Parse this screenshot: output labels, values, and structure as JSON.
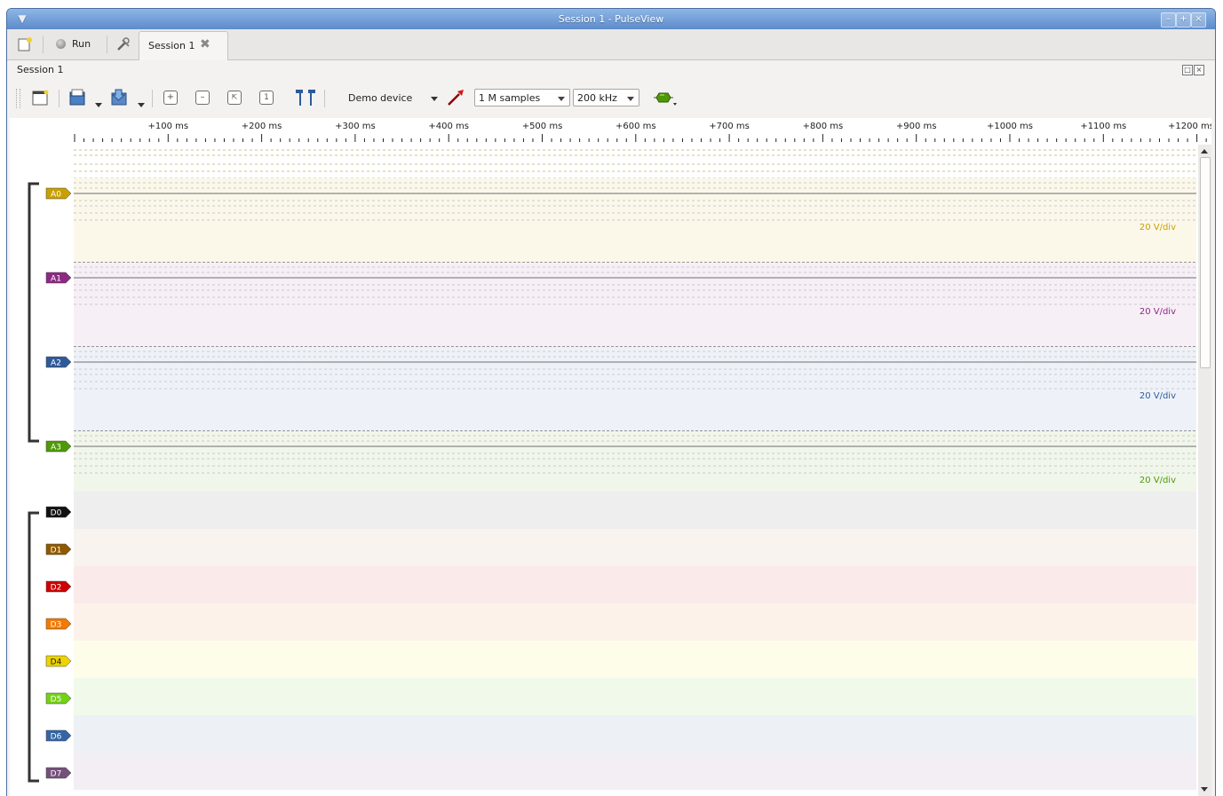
{
  "window": {
    "title": "Session 1 - PulseView"
  },
  "tabbar": {
    "run_label": "Run",
    "session_tab_label": "Session 1"
  },
  "dock": {
    "title": "Session 1"
  },
  "toolbar": {
    "device": "Demo device",
    "samples": "1 M samples",
    "rate": "200 kHz"
  },
  "ruler": {
    "labels": [
      "+100 ms",
      "+200 ms",
      "+300 ms",
      "+400 ms",
      "+500 ms",
      "+600 ms",
      "+700 ms",
      "+800 ms",
      "+900 ms",
      "+1000 ms",
      "+1100 ms",
      "+1200 ms"
    ]
  },
  "analog_channels": [
    {
      "name": "A0",
      "scale": "20 V/div",
      "color": "#c8a000",
      "bg": "#fbf8ea"
    },
    {
      "name": "A1",
      "scale": "20 V/div",
      "color": "#8b2a82",
      "bg": "#f7eff6"
    },
    {
      "name": "A2",
      "scale": "20 V/div",
      "color": "#2f5a9a",
      "bg": "#eef2f8"
    },
    {
      "name": "A3",
      "scale": "20 V/div",
      "color": "#4e9a06",
      "bg": "#f0f6ea"
    }
  ],
  "digital_channels": [
    {
      "name": "D0",
      "color": "#111111",
      "bg": "#eeeeee"
    },
    {
      "name": "D1",
      "color": "#8f5902",
      "bg": "#f8f3ee"
    },
    {
      "name": "D2",
      "color": "#cc0000",
      "bg": "#fbeaea"
    },
    {
      "name": "D3",
      "color": "#f57900",
      "bg": "#fdf2ea"
    },
    {
      "name": "D4",
      "color": "#edd400",
      "bg": "#fefdea"
    },
    {
      "name": "D5",
      "color": "#73d216",
      "bg": "#f1f9ea"
    },
    {
      "name": "D6",
      "color": "#3465a4",
      "bg": "#edf1f6"
    },
    {
      "name": "D7",
      "color": "#75507b",
      "bg": "#f2eef3"
    }
  ]
}
